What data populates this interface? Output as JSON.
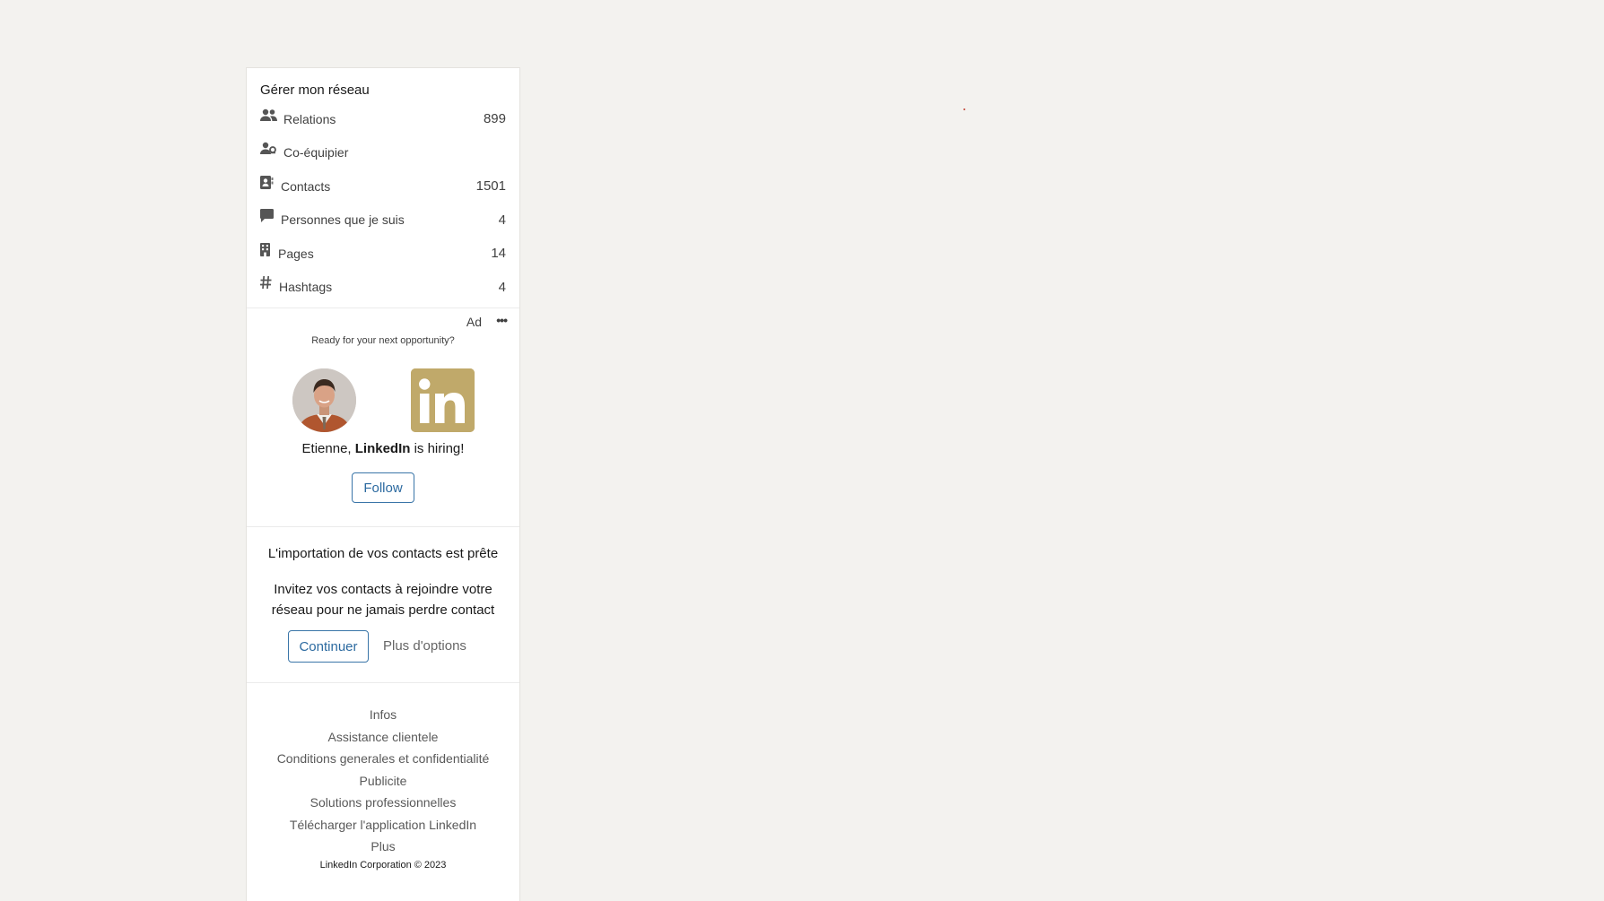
{
  "network": {
    "title": "Gérer mon réseau",
    "items": [
      {
        "label": "Relations",
        "count": "899",
        "icon": "people-icon"
      },
      {
        "label": "Co-équipier",
        "count": "",
        "icon": "person-group-icon"
      },
      {
        "label": "Contacts",
        "count": "1501",
        "icon": "address-book-icon"
      },
      {
        "label": "Personnes que je suis",
        "count": "4",
        "icon": "speech-bubble-icon"
      },
      {
        "label": "Pages",
        "count": "14",
        "icon": "building-icon"
      },
      {
        "label": "Hashtags",
        "count": "4",
        "icon": "hashtag-icon"
      }
    ]
  },
  "ad": {
    "label": "Ad",
    "more": "•••",
    "tagline": "Ready for your next opportunity?",
    "headline_prefix": "Etienne, ",
    "headline_brand": "LinkedIn",
    "headline_suffix": " is hiring!",
    "follow_label": "Follow",
    "brand_color": "#c0a96a"
  },
  "import": {
    "title": "L'importation de vos contacts est prête",
    "body": "Invitez vos contacts à rejoindre votre réseau pour ne jamais perdre contact",
    "continue_label": "Continuer",
    "more_options_label": "Plus d'options"
  },
  "footer": {
    "links": [
      "Infos",
      "Assistance clientele",
      "Conditions generales et confidentialité",
      "Publicite",
      "Solutions professionnelles",
      "Télécharger l'application LinkedIn",
      "Plus"
    ],
    "copyright": "LinkedIn Corporation © 2023"
  }
}
